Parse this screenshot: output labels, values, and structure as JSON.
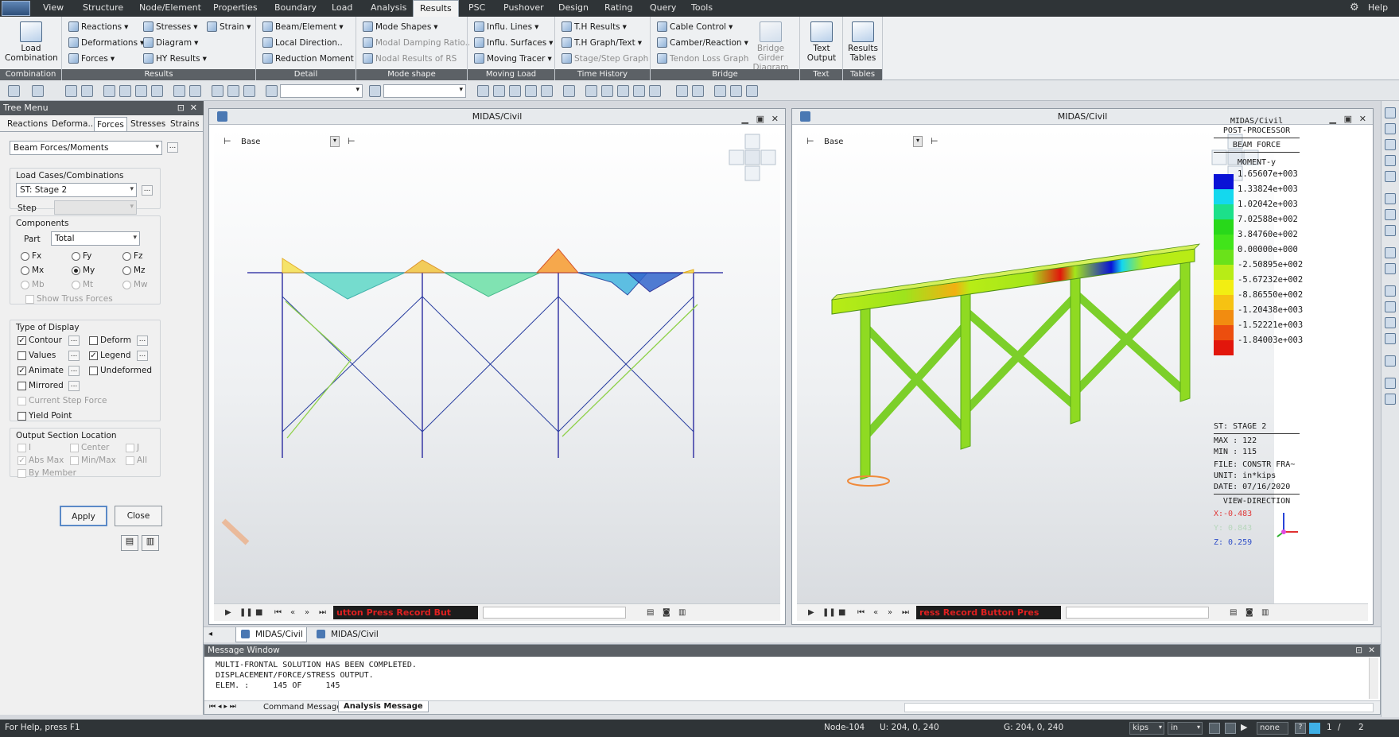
{
  "menubar": {
    "tabs": [
      "View",
      "Structure",
      "Node/Element",
      "Properties",
      "Boundary",
      "Load",
      "Analysis",
      "Results",
      "PSC",
      "Pushover",
      "Design",
      "Rating",
      "Query",
      "Tools"
    ],
    "active_tab": "Results",
    "help": "Help"
  },
  "ribbon": {
    "groups": {
      "combination": "Combination",
      "results": "Results",
      "detail": "Detail",
      "mode_shape": "Mode shape",
      "moving_load": "Moving Load",
      "time_history": "Time History",
      "bridge": "Bridge",
      "text": "Text",
      "tables": "Tables"
    },
    "load_combination": "Load Combination",
    "reactions": "Reactions",
    "deformations": "Deformations",
    "forces": "Forces",
    "stresses": "Stresses",
    "diagram": "Diagram",
    "hy_results": "HY Results",
    "strain": "Strain",
    "beam_element": "Beam/Element",
    "local_direction": "Local Direction..",
    "reduction_moment": "Reduction Moment",
    "mode_shapes": "Mode Shapes",
    "modal_damping": "Modal Damping Ratio..",
    "nodal_results_rs": "Nodal Results of RS",
    "influ_lines": "Influ. Lines",
    "influ_surfaces": "Influ. Surfaces",
    "moving_tracer": "Moving Tracer",
    "th_results": "T.H Results",
    "th_graph_text": "T.H Graph/Text",
    "stage_step_graph": "Stage/Step Graph",
    "cable_control": "Cable Control",
    "camber_reaction": "Camber/Reaction",
    "tendon_loss_graph": "Tendon Loss Graph",
    "bridge_girder_diagram": "Bridge Girder Diagram",
    "text_output": "Text Output",
    "results_tables": "Results Tables"
  },
  "tree": {
    "title": "Tree Menu",
    "tabs": [
      "Reactions",
      "Deforma...",
      "Forces",
      "Stresses",
      "Strains"
    ],
    "active_tab": "Forces",
    "result_type": "Beam Forces/Moments",
    "load_cases_label": "Load Cases/Combinations",
    "load_case_value": "ST: Stage 2",
    "step_label": "Step",
    "components_label": "Components",
    "part_label": "Part",
    "part_value": "Total",
    "radios": {
      "fx": "Fx",
      "fy": "Fy",
      "fz": "Fz",
      "mx": "Mx",
      "my": "My",
      "mz": "Mz",
      "mb": "Mb",
      "mt": "Mt",
      "mw": "Mw"
    },
    "selected_component": "My",
    "show_truss_forces": "Show Truss Forces",
    "type_of_display": "Type of Display",
    "contour": "Contour",
    "deform": "Deform",
    "values": "Values",
    "legend": "Legend",
    "animate": "Animate",
    "undeformed": "Undeformed",
    "mirrored": "Mirrored",
    "current_step_force": "Current Step Force",
    "yield_point": "Yield Point",
    "output_section_location": "Output Section Location",
    "loc_i": "I",
    "loc_center": "Center",
    "loc_j": "J",
    "abs_max": "Abs Max",
    "min_max": "Min/Max",
    "loc_all": "All",
    "by_member": "By Member",
    "apply": "Apply",
    "close": "Close"
  },
  "windows": {
    "title": "MIDAS/Civil",
    "view_base": "Base",
    "record_left": "utton          Press Record But",
    "record_right": "ress Record Button          Pres"
  },
  "legend": {
    "header1": "MIDAS/Civil",
    "header2": "POST-PROCESSOR",
    "title": "BEAM FORCE",
    "subtitle": "MOMENT-y",
    "entries": [
      {
        "value": "1.65607e+003",
        "color": "#0a12d6"
      },
      {
        "value": "1.33824e+003",
        "color": "#14d8ee"
      },
      {
        "value": "1.02042e+003",
        "color": "#1ce08a"
      },
      {
        "value": "7.02588e+002",
        "color": "#28d81a"
      },
      {
        "value": "3.84760e+002",
        "color": "#41e41a"
      },
      {
        "value": "0.00000e+000",
        "color": "#6ae21a"
      },
      {
        "value": "-2.50895e+002",
        "color": "#b8ec16"
      },
      {
        "value": "-5.67232e+002",
        "color": "#f2ee12"
      },
      {
        "value": "-8.86550e+002",
        "color": "#f6c212"
      },
      {
        "value": "-1.20438e+003",
        "color": "#f28c10"
      },
      {
        "value": "-1.52221e+003",
        "color": "#ec4e0e"
      },
      {
        "value": "-1.84003e+003",
        "color": "#e2160c"
      }
    ],
    "stage": "ST: STAGE 2",
    "max": "MAX : 122",
    "min": "MIN : 115",
    "file": "FILE: CONSTR FRA~",
    "unit": "UNIT: in*kips",
    "date": "DATE: 07/16/2020",
    "view_direction": "VIEW-DIRECTION",
    "x_dir": "X:-0.483",
    "y_dir": "Y: 0.843",
    "z_dir": "Z: 0.259"
  },
  "doc_tabs": [
    "MIDAS/Civil",
    "MIDAS/Civil"
  ],
  "message": {
    "title": "Message Window",
    "lines": [
      "MULTI-FRONTAL SOLUTION HAS BEEN COMPLETED.",
      "DISPLACEMENT/FORCE/STRESS OUTPUT.",
      "ELEM. :     145 OF     145"
    ],
    "tabs": [
      "Command Message",
      "Analysis Message"
    ],
    "active_tab": "Analysis Message"
  },
  "status": {
    "help": "For Help, press F1",
    "node": "Node-104",
    "u": "U: 204, 0, 240",
    "g": "G: 204, 0, 240",
    "force_unit": "kips",
    "length_unit": "in",
    "filter": "none",
    "page": "1",
    "of": "2"
  }
}
